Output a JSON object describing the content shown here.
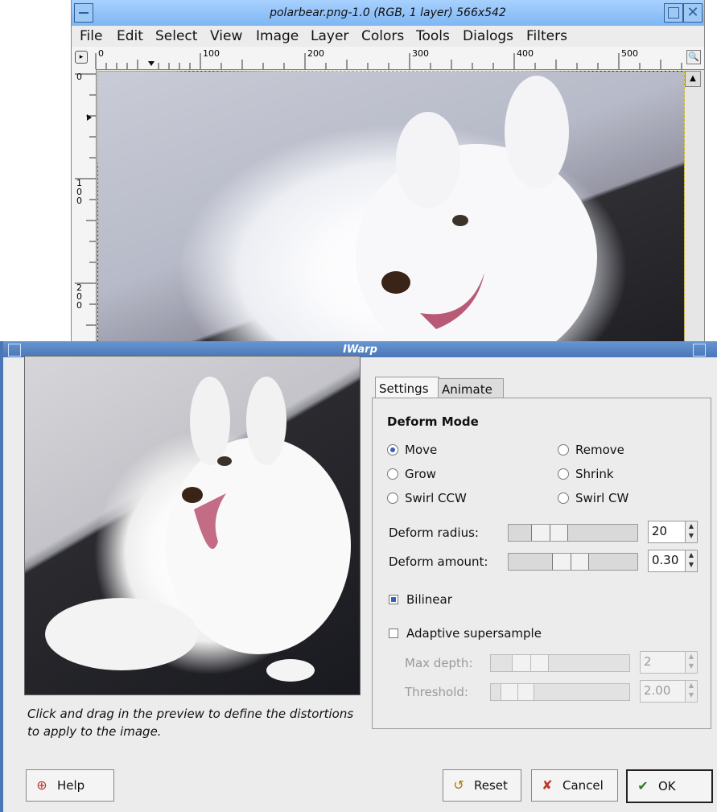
{
  "image_window": {
    "title": "polarbear.png-1.0 (RGB, 1 layer) 566x542",
    "menu": [
      "File",
      "Edit",
      "Select",
      "View",
      "Image",
      "Layer",
      "Colors",
      "Tools",
      "Dialogs",
      "Filters"
    ],
    "ruler_top_labels": [
      "0",
      "100",
      "200",
      "300",
      "400",
      "500"
    ],
    "ruler_left_labels": [
      "0",
      "1\n0\n0",
      "2\n0\n0"
    ]
  },
  "dialog": {
    "title": "IWarp",
    "hint": "Click and drag in the preview to define the distortions to apply to the image.",
    "tabs": [
      "Settings",
      "Animate"
    ],
    "deform_mode": {
      "title": "Deform Mode",
      "options": [
        "Move",
        "Remove",
        "Grow",
        "Shrink",
        "Swirl CCW",
        "Swirl CW"
      ],
      "selected": "Move"
    },
    "deform_radius": {
      "label": "Deform radius:",
      "value": "20"
    },
    "deform_amount": {
      "label": "Deform amount:",
      "value": "0.30"
    },
    "bilinear": {
      "label": "Bilinear",
      "checked": true
    },
    "adaptive_supersample": {
      "label": "Adaptive supersample",
      "checked": false
    },
    "max_depth": {
      "label": "Max depth:",
      "value": "2"
    },
    "threshold": {
      "label": "Threshold:",
      "value": "2.00"
    },
    "buttons": {
      "help": "Help",
      "reset": "Reset",
      "cancel": "Cancel",
      "ok": "OK"
    }
  },
  "colors": {
    "titlebar_active": "#4a76b6",
    "titlebar_inactive": "#a7d1ff",
    "radio_accent": "#3b5fb8"
  }
}
